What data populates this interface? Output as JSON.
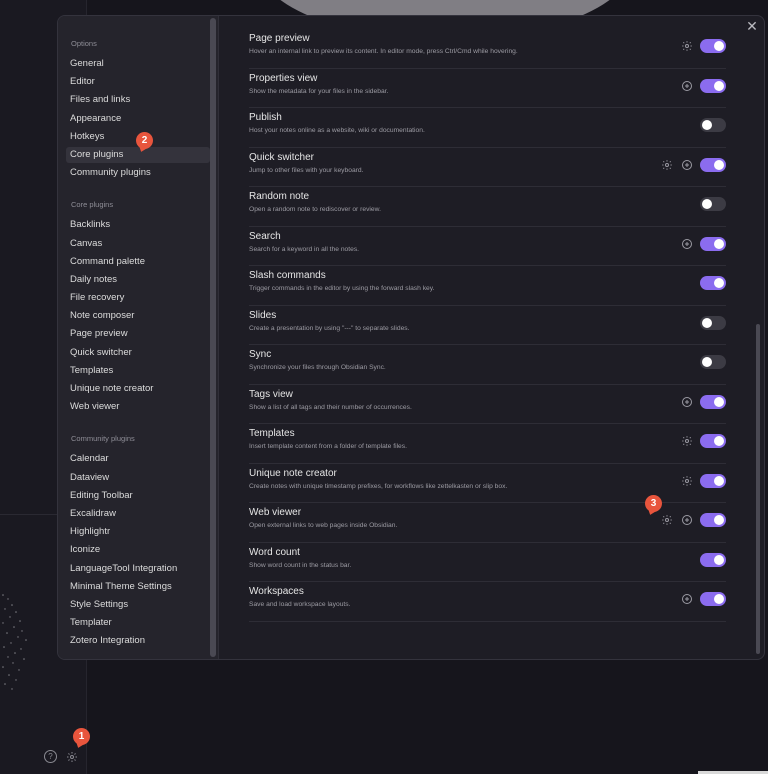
{
  "sidebar": {
    "options_header": "Options",
    "options_items": [
      {
        "label": "General",
        "active": false
      },
      {
        "label": "Editor",
        "active": false
      },
      {
        "label": "Files and links",
        "active": false
      },
      {
        "label": "Appearance",
        "active": false
      },
      {
        "label": "Hotkeys",
        "active": false
      },
      {
        "label": "Core plugins",
        "active": true
      },
      {
        "label": "Community plugins",
        "active": false
      }
    ],
    "core_header": "Core plugins",
    "core_items": [
      "Backlinks",
      "Canvas",
      "Command palette",
      "Daily notes",
      "File recovery",
      "Note composer",
      "Page preview",
      "Quick switcher",
      "Templates",
      "Unique note creator",
      "Web viewer"
    ],
    "community_header": "Community plugins",
    "community_items": [
      "Calendar",
      "Dataview",
      "Editing Toolbar",
      "Excalidraw",
      "Highlightr",
      "Iconize",
      "LanguageTool Integration",
      "Minimal Theme Settings",
      "Style Settings",
      "Templater",
      "Zotero Integration"
    ]
  },
  "close_icon": "close-icon",
  "badges": {
    "one": "1",
    "two": "2",
    "three": "3"
  },
  "accent_color": "#8b6cef",
  "badge_color": "#e8553d",
  "plugins": [
    {
      "name": "Page preview",
      "desc": "Hover an internal link to preview its content. In editor mode, press Ctrl/Cmd while hovering.",
      "gear": true,
      "plus": false,
      "on": true
    },
    {
      "name": "Properties view",
      "desc": "Show the metadata for your files in the sidebar.",
      "gear": false,
      "plus": true,
      "on": true
    },
    {
      "name": "Publish",
      "desc": "Host your notes online as a website, wiki or documentation.",
      "gear": false,
      "plus": false,
      "on": false
    },
    {
      "name": "Quick switcher",
      "desc": "Jump to other files with your keyboard.",
      "gear": true,
      "plus": true,
      "on": true
    },
    {
      "name": "Random note",
      "desc": "Open a random note to rediscover or review.",
      "gear": false,
      "plus": false,
      "on": false
    },
    {
      "name": "Search",
      "desc": "Search for a keyword in all the notes.",
      "gear": false,
      "plus": true,
      "on": true
    },
    {
      "name": "Slash commands",
      "desc": "Trigger commands in the editor by using the forward slash key.",
      "gear": false,
      "plus": false,
      "on": true
    },
    {
      "name": "Slides",
      "desc": "Create a presentation by using \"---\" to separate slides.",
      "gear": false,
      "plus": false,
      "on": false
    },
    {
      "name": "Sync",
      "desc": "Synchronize your files through Obsidian Sync.",
      "gear": false,
      "plus": false,
      "on": false
    },
    {
      "name": "Tags view",
      "desc": "Show a list of all tags and their number of occurrences.",
      "gear": false,
      "plus": true,
      "on": true
    },
    {
      "name": "Templates",
      "desc": "Insert template content from a folder of template files.",
      "gear": true,
      "plus": false,
      "on": true
    },
    {
      "name": "Unique note creator",
      "desc": "Create notes with unique timestamp prefixes, for workflows like zettelkasten or slip box.",
      "gear": true,
      "plus": false,
      "on": true
    },
    {
      "name": "Web viewer",
      "desc": "Open external links to web pages inside Obsidian.",
      "gear": true,
      "plus": true,
      "on": true
    },
    {
      "name": "Word count",
      "desc": "Show word count in the status bar.",
      "gear": false,
      "plus": false,
      "on": true
    },
    {
      "name": "Workspaces",
      "desc": "Save and load workspace layouts.",
      "gear": false,
      "plus": true,
      "on": true
    }
  ],
  "rail": {
    "help_icon": "help-icon",
    "settings_icon": "gear-icon",
    "help_glyph": "?"
  }
}
